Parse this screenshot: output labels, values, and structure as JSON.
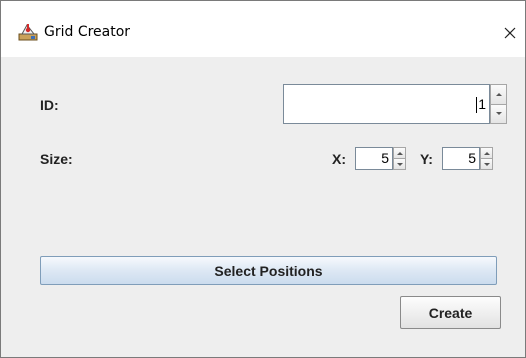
{
  "window": {
    "title": "Grid Creator",
    "app_icon": "grid-creator-app-icon",
    "close_icon": "close-icon"
  },
  "form": {
    "id_label": "ID:",
    "id_value": "1",
    "size_label": "Size:",
    "x_label": "X:",
    "x_value": "5",
    "y_label": "Y:",
    "y_value": "5"
  },
  "buttons": {
    "select_positions": "Select Positions",
    "create": "Create"
  },
  "colors": {
    "window_background": "#eeeeee",
    "titlebar_background": "#ffffff",
    "select_button_gradient_top": "#f6f9fd",
    "select_button_gradient_bottom": "#cbdcee"
  }
}
